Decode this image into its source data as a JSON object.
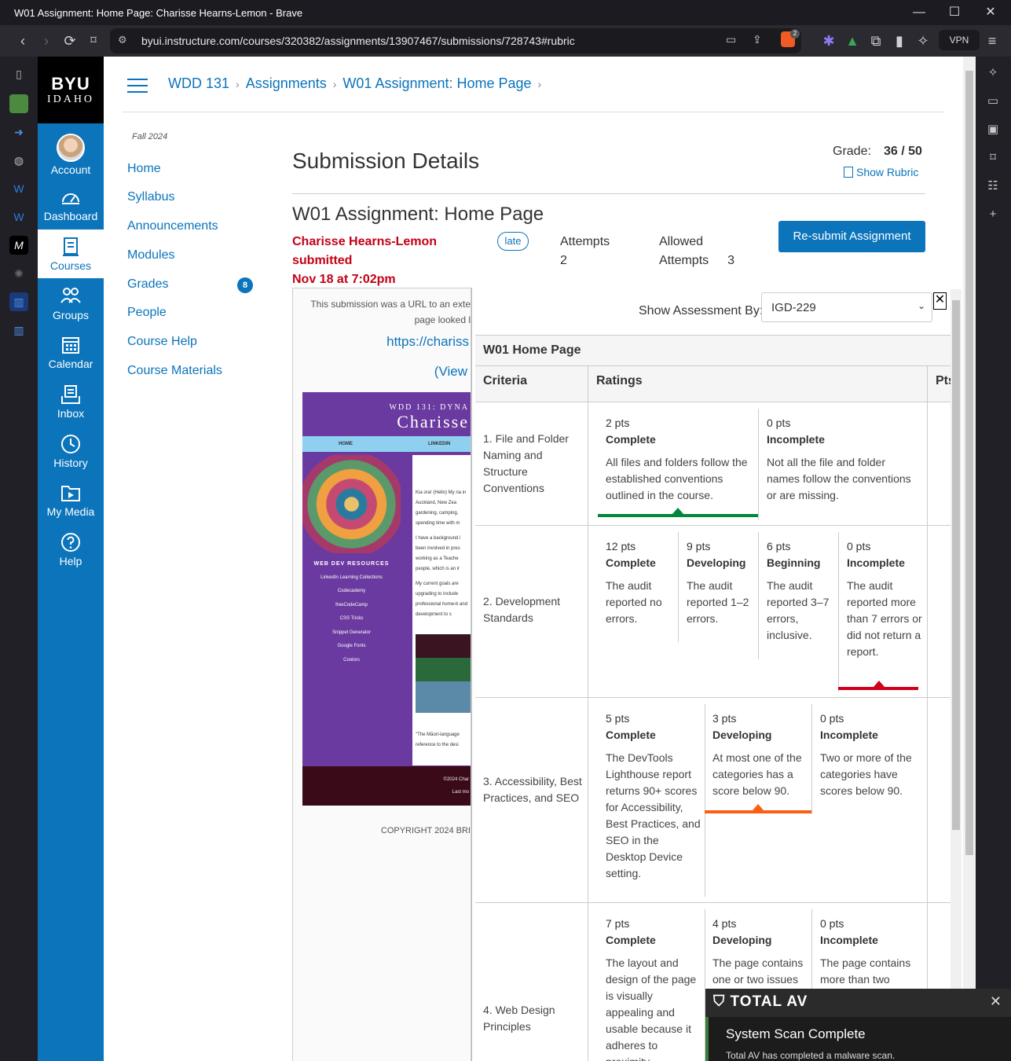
{
  "browser": {
    "window_title": "W01 Assignment: Home Page: Charisse Hearns-Lemon - Brave",
    "url": "byui.instructure.com/courses/320382/assignments/13907467/submissions/728743#rubric",
    "vpn_label": "VPN",
    "shield_count": "2"
  },
  "global_nav": {
    "logo_top": "BYU",
    "logo_bottom": "IDAHO",
    "items": [
      {
        "label": "Account",
        "icon": "avatar"
      },
      {
        "label": "Dashboard",
        "icon": "dashboard-icon"
      },
      {
        "label": "Courses",
        "icon": "courses-icon"
      },
      {
        "label": "Groups",
        "icon": "groups-icon"
      },
      {
        "label": "Calendar",
        "icon": "calendar-icon"
      },
      {
        "label": "Inbox",
        "icon": "inbox-icon"
      },
      {
        "label": "History",
        "icon": "history-icon"
      },
      {
        "label": "My Media",
        "icon": "media-icon"
      },
      {
        "label": "Help",
        "icon": "help-icon"
      }
    ]
  },
  "breadcrumbs": [
    "WDD 131",
    "Assignments",
    "W01 Assignment: Home Page"
  ],
  "course_nav": {
    "term": "Fall 2024",
    "items": [
      "Home",
      "Syllabus",
      "Announcements",
      "Modules",
      "Grades",
      "People",
      "Course Help",
      "Course Materials"
    ],
    "grades_badge": "8"
  },
  "submission": {
    "heading": "Submission Details",
    "grade_label": "Grade:",
    "grade_value": "36 / 50",
    "show_rubric": "Show Rubric",
    "assignment_name": "W01 Assignment: Home Page",
    "submitter_line1": "Charisse Hearns-Lemon submitted",
    "submitter_line2": "Nov 18 at 7:02pm",
    "late_badge": "late",
    "attempts_label": "Attempts",
    "attempts_value": "2",
    "allowed_label1": "Allowed",
    "allowed_label2": "Attempts",
    "allowed_value": "3",
    "resubmit_button": "Re-submit Assignment"
  },
  "preview": {
    "line1": "This submission was a URL to an exte",
    "line2": "page looked l",
    "url_text": "https://chariss",
    "view_text": "(View",
    "site_header_small": "WDD 131: DYNA",
    "site_header_name": "Charisse",
    "site_nav_home": "HOME",
    "site_nav_linkedin": "LINKEDIN",
    "site_resources_title": "WEB DEV RESOURCES",
    "site_resources": [
      "LinkedIn Learning Collections",
      "Codecademy",
      "freeCodeCamp",
      "CSS Tricks",
      "Snippet Generator",
      "Google Fonts",
      "Coolors"
    ],
    "site_body_1": "Kia ora! (Hello) My na in Auckland, New Zea gardening, camping, spending time with m",
    "site_body_2": "I have a background i been involved in pres working as a Teache people, which is an ir",
    "site_body_3": "My current goals are upgrading to include professional home-b and development to s",
    "site_body_4": "\"The Māori-language reference to the desi",
    "site_footer_1": "©2024 Char",
    "site_footer_2": "Last mo",
    "copyright": "COPYRIGHT 2024 BRI"
  },
  "rubric": {
    "show_by_label": "Show Assessment By:",
    "assessor": "IGD-229",
    "title": "W01 Home Page",
    "col_criteria": "Criteria",
    "col_ratings": "Ratings",
    "col_pts": "Pts",
    "criteria": [
      {
        "name": "1. File and Folder Naming and Structure Conventions",
        "ratings": [
          {
            "pts": "2 pts",
            "name": "Complete",
            "desc": "All files and folders follow the established conventions outlined in the course.",
            "selected": true
          },
          {
            "pts": "0 pts",
            "name": "Incomplete",
            "desc": "Not all the file and folder names follow the conventions or are missing.",
            "selected": false
          }
        ]
      },
      {
        "name": "2. Development Standards",
        "ratings": [
          {
            "pts": "12 pts",
            "name": "Complete",
            "desc": "The audit reported no errors.",
            "selected": false
          },
          {
            "pts": "9 pts",
            "name": "Developing",
            "desc": "The audit reported 1–2 errors.",
            "selected": false
          },
          {
            "pts": "6 pts",
            "name": "Beginning",
            "desc": "The audit reported 3–7 errors, inclusive.",
            "selected": false
          },
          {
            "pts": "0 pts",
            "name": "Incomplete",
            "desc": "The audit reported more than 7 errors or did not return a report.",
            "selected": true
          }
        ]
      },
      {
        "name": "3. Accessibility, Best Practices, and SEO",
        "ratings": [
          {
            "pts": "5 pts",
            "name": "Complete",
            "desc": "The DevTools Lighthouse report returns 90+ scores for Accessibility, Best Practices, and SEO in the Desktop Device setting.",
            "selected": false
          },
          {
            "pts": "3 pts",
            "name": "Developing",
            "desc": "At most one of the categories has a score below 90.",
            "selected": true
          },
          {
            "pts": "0 pts",
            "name": "Incomplete",
            "desc": "Two or more of the categories have scores below 90.",
            "selected": false
          }
        ]
      },
      {
        "name": "4. Web Design Principles",
        "ratings": [
          {
            "pts": "7 pts",
            "name": "Complete",
            "desc": "The layout and design of the page is visually appealing and usable because it adheres to proximity",
            "selected": false
          },
          {
            "pts": "4 pts",
            "name": "Developing",
            "desc": "The page contains one or two issues",
            "selected": false
          },
          {
            "pts": "0 pts",
            "name": "Incomplete",
            "desc": "The page contains more than two",
            "selected": false
          }
        ]
      }
    ]
  },
  "toast": {
    "brand": "TOTAL AV",
    "title": "System Scan Complete",
    "message": "Total AV has completed a malware scan."
  },
  "colors": {
    "canvas_blue": "#0b74bb",
    "late_red": "#c40015",
    "complete_green": "#00873c",
    "incomplete_red": "#d0021b",
    "developing_orange": "#fc5e13"
  }
}
